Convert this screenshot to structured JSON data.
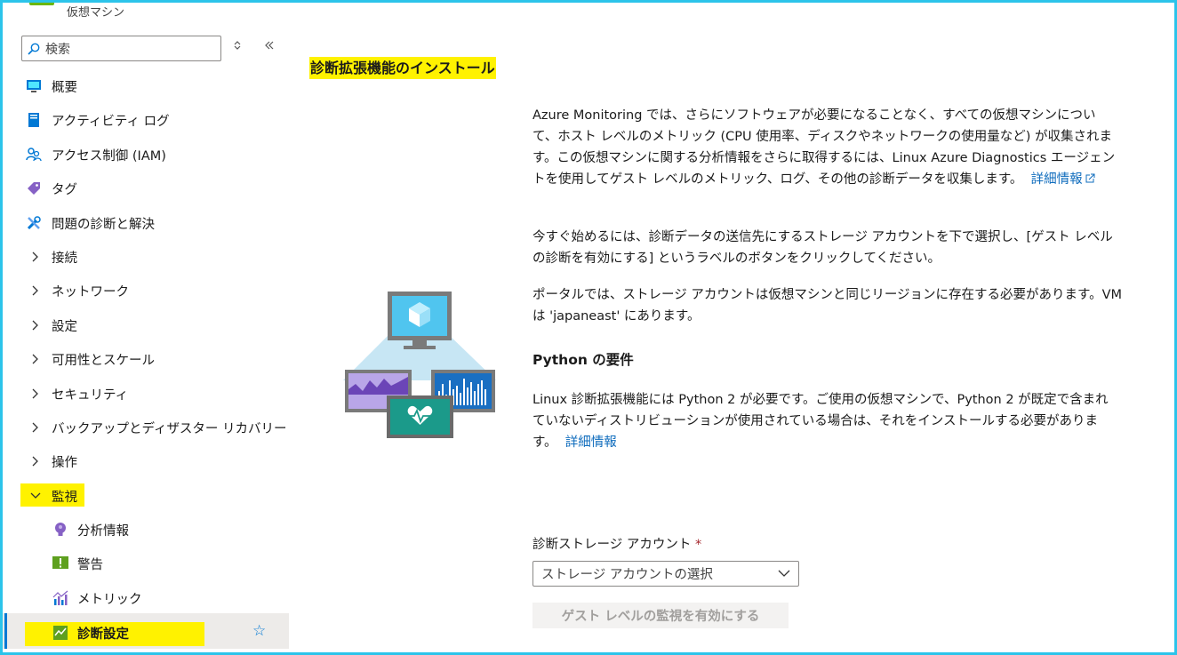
{
  "sidebar": {
    "subtitle": "仮想マシン",
    "search_placeholder": "検索",
    "items": [
      {
        "label": "概要"
      },
      {
        "label": "アクティビティ ログ"
      },
      {
        "label": "アクセス制御 (IAM)"
      },
      {
        "label": "タグ"
      },
      {
        "label": "問題の診断と解決"
      },
      {
        "label": "接続"
      },
      {
        "label": "ネットワーク"
      },
      {
        "label": "設定"
      },
      {
        "label": "可用性とスケール"
      },
      {
        "label": "セキュリティ"
      },
      {
        "label": "バックアップとディザスター リカバリー"
      },
      {
        "label": "操作"
      },
      {
        "label": "監視"
      },
      {
        "label": "分析情報"
      },
      {
        "label": "警告"
      },
      {
        "label": "メトリック"
      },
      {
        "label": "診断設定"
      }
    ],
    "colors": {
      "highlight": "#fff200",
      "accent": "#0078d4"
    }
  },
  "main": {
    "title": "診断拡張機能のインストール",
    "p1_text": "Azure Monitoring では、さらにソフトウェアが必要になることなく、すべての仮想マシンについて、ホスト レベルのメトリック (CPU 使用率、ディスクやネットワークの使用量など) が収集されます。この仮想マシンに関する分析情報をさらに取得するには、Linux Azure Diagnostics エージェントを使用してゲスト レベルのメトリック、ログ、その他の診断データを収集します。",
    "p1_link": "詳細情報",
    "p2_text": "今すぐ始めるには、診断データの送信先にするストレージ アカウントを下で選択し、[ゲスト レベルの診断を有効にする] というラベルのボタンをクリックしてください。",
    "p3_text": "ポータルでは、ストレージ アカウントは仮想マシンと同じリージョンに存在する必要があります。VM は 'japaneast' にあります。",
    "python_heading": "Python の要件",
    "p4_text": "Linux 診断拡張機能には Python 2 が必要です。ご使用の仮想マシンで、Python 2 が既定で含まれていないディストリビューションが使用されている場合は、それをインストールする必要があります。",
    "p4_link": "詳細情報",
    "storage_label": "診断ストレージ アカウント",
    "required_mark": "*",
    "storage_select_placeholder": "ストレージ アカウントの選択",
    "enable_button": "ゲスト レベルの監視を有効にする"
  }
}
